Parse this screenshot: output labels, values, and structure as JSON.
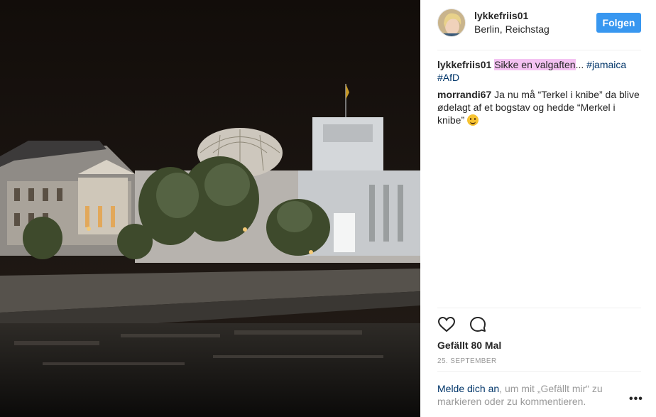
{
  "post": {
    "username": "lykkefriis01",
    "location": "Berlin, Reichstag",
    "follow_label": "Folgen",
    "likes_text": "Gefällt 80 Mal",
    "date": "25. SEPTEMBER"
  },
  "comments": [
    {
      "user": "lykkefriis01",
      "highlighted": "Sikke en valgaften",
      "ellipsis": "...",
      "tag1": "#jamaica",
      "tag2": "#AfD"
    },
    {
      "user": "morrandi67",
      "text": "Ja nu må “Terkel i knibe” da blive ødelagt af et bogstav og hedde “Merkel i knibe”",
      "emoji": "smiling-face-emoji"
    }
  ],
  "footer": {
    "login_link": "Melde dich an",
    "login_suffix": ", um mit „Gefällt mir“ zu markieren oder zu kommentieren.",
    "more_label": "•••"
  },
  "icons": {
    "like": "heart-icon",
    "comment": "comment-bubble-icon",
    "more": "more-options-icon"
  },
  "colors": {
    "follow_button": "#3897f0",
    "hashtag": "#003569",
    "highlight": "#f4c2f2"
  }
}
